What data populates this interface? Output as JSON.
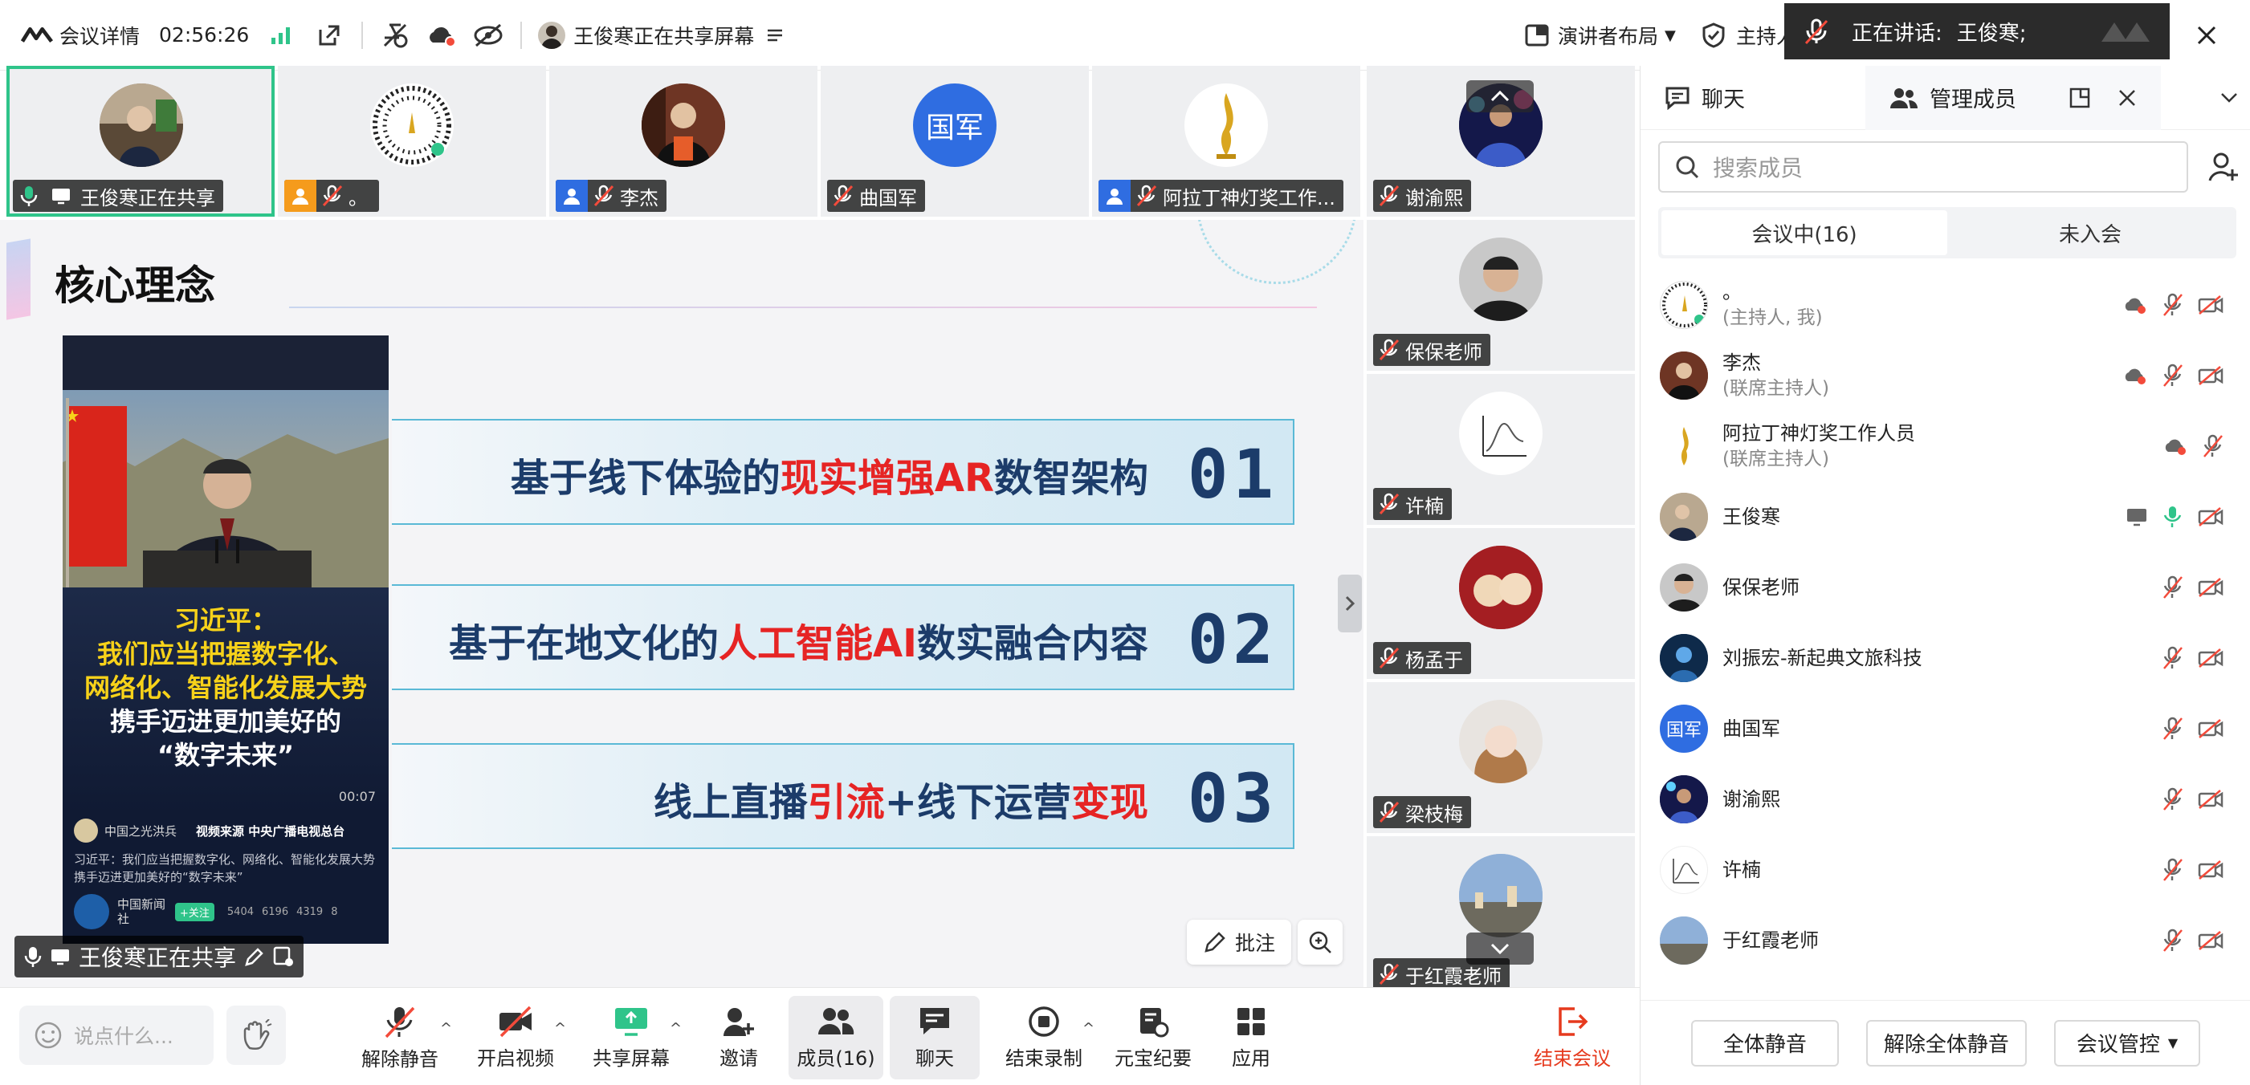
{
  "topbar": {
    "meeting_details": "会议详情",
    "timer": "02:56:26",
    "sharing_text": "王俊寒正在共享屏幕",
    "layout_label": "演讲者布局",
    "host_label": "主持人"
  },
  "speaking_toast": {
    "label": "正在讲话:",
    "name": "王俊寒;"
  },
  "video_strip": [
    {
      "name": "王俊寒正在共享",
      "active": true
    },
    {
      "name": "。"
    },
    {
      "name": "李杰"
    },
    {
      "name": "曲国军",
      "avatar_text": "国军"
    },
    {
      "name": "阿拉丁神灯奖工作..."
    }
  ],
  "right_column": [
    {
      "name": "谢渝熙"
    },
    {
      "name": "保保老师"
    },
    {
      "name": "许楠"
    },
    {
      "name": "杨孟于"
    },
    {
      "name": "梁枝梅"
    },
    {
      "name": "于红霞老师"
    }
  ],
  "slide": {
    "title": "核心理念",
    "banners": [
      {
        "pre": "基于线下体验的",
        "red": "现实增强AR",
        "post": "数智架构",
        "num": "01"
      },
      {
        "pre": "基于在地文化的",
        "red": "人工智能AI",
        "post": "数实融合内容",
        "num": "02"
      },
      {
        "pre": "线上直播",
        "red": "引流",
        "post": "+线下运营",
        "red2": "变现",
        "num": "03"
      }
    ],
    "video": {
      "caption_name": "习近平：",
      "caption_l1": "我们应当把握数字化、",
      "caption_l2": "网络化、智能化发展大势",
      "caption_l3": "携手迈进更加美好的",
      "caption_l4": "“数字未来”",
      "time": "00:07",
      "source_account": "中国之光洪兵",
      "source_label": "视频来源 中央广播电视总台",
      "desc": "习近平：我们应当把握数字化、网络化、智能化发展大势 携手迈进更加美好的“数字未来”",
      "publisher": "中国新闻社",
      "follow": "+关注",
      "stats": [
        "5404",
        "6196",
        "4319",
        "8"
      ]
    },
    "sharer_label": "王俊寒正在共享",
    "annotate": "批注"
  },
  "panel": {
    "tab_chat": "聊天",
    "tab_members": "管理成员",
    "search_placeholder": "搜索成员",
    "seg_in": "会议中(16)",
    "seg_out": "未入会",
    "members": [
      {
        "name": "。",
        "role": "(主持人, 我)"
      },
      {
        "name": "李杰",
        "role": "(联席主持人)"
      },
      {
        "name": "阿拉丁神灯奖工作人员",
        "role": "(联席主持人)"
      },
      {
        "name": "王俊寒",
        "role": ""
      },
      {
        "name": "保保老师",
        "role": ""
      },
      {
        "name": "刘振宏-新起典文旅科技",
        "role": ""
      },
      {
        "name": "曲国军",
        "role": "",
        "avatar_text": "国军"
      },
      {
        "name": "谢渝熙",
        "role": ""
      },
      {
        "name": "许楠",
        "role": ""
      },
      {
        "name": "于红霞老师",
        "role": ""
      }
    ],
    "mute_all": "全体静音",
    "unmute_all": "解除全体静音",
    "control": "会议管控"
  },
  "toolbar": {
    "say_placeholder": "说点什么...",
    "unmute": "解除静音",
    "video": "开启视频",
    "share": "共享屏幕",
    "invite": "邀请",
    "members": "成员(16)",
    "chat": "聊天",
    "record": "结束录制",
    "minutes": "元宝纪要",
    "apps": "应用",
    "end": "结束会议"
  },
  "colors": {
    "accent_green": "#2fc48a",
    "brand_blue": "#2f6de1",
    "end_red": "#e63a1e",
    "slide_red": "#e62424",
    "slide_navy": "#1c3c6a"
  }
}
